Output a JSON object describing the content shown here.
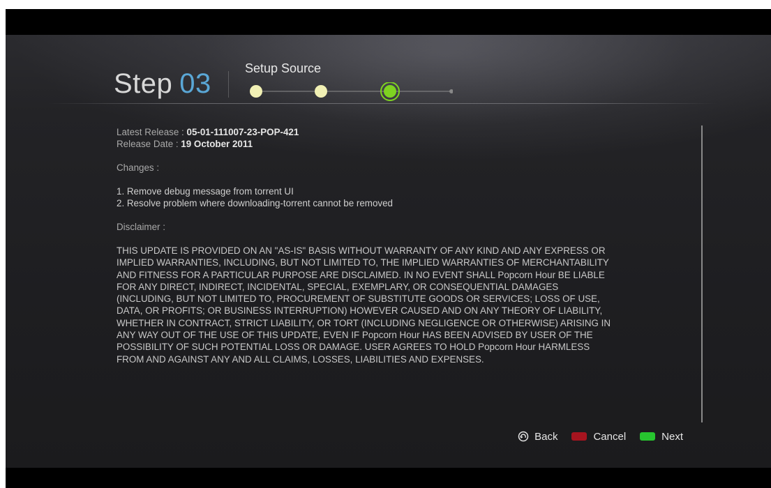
{
  "header": {
    "step_word": "Step",
    "step_number": "03",
    "title": "Setup Source",
    "progress": {
      "total_steps": 4,
      "current_step": 3,
      "completed_color": "#f1f0b4",
      "active_color": "#7ed321",
      "pending_color": "#888888"
    }
  },
  "release": {
    "latest_label": "Latest Release : ",
    "latest_value": "05-01-111007-23-POP-421",
    "date_label": "Release Date : ",
    "date_value": "19 October 2011"
  },
  "changes": {
    "heading": "Changes :",
    "items": [
      "1. Remove debug message from torrent UI",
      "2. Resolve problem where downloading-torrent cannot be removed"
    ]
  },
  "disclaimer": {
    "heading": "Disclaimer :",
    "lines": [
      "THIS UPDATE IS PROVIDED ON AN \"AS-IS\" BASIS WITHOUT WARRANTY OF ANY KIND AND ANY EXPRESS OR",
      "IMPLIED WARRANTIES, INCLUDING, BUT NOT LIMITED TO, THE IMPLIED WARRANTIES OF MERCHANTABILITY",
      "AND FITNESS FOR A PARTICULAR PURPOSE ARE DISCLAIMED. IN NO EVENT SHALL Popcorn Hour BE LIABLE",
      "FOR ANY DIRECT, INDIRECT, INCIDENTAL, SPECIAL, EXEMPLARY, OR CONSEQUENTIAL DAMAGES",
      "(INCLUDING, BUT NOT LIMITED TO, PROCUREMENT OF SUBSTITUTE GOODS OR SERVICES; LOSS OF USE,",
      "DATA, OR PROFITS; OR BUSINESS INTERRUPTION) HOWEVER CAUSED AND ON ANY THEORY OF LIABILITY,",
      "WHETHER IN CONTRACT, STRICT LIABILITY, OR TORT (INCLUDING NEGLIGENCE OR OTHERWISE) ARISING IN",
      "ANY WAY OUT OF THE USE OF THIS UPDATE, EVEN IF Popcorn Hour HAS BEEN ADVISED BY USER OF THE",
      "POSSIBILITY OF SUCH POTENTIAL LOSS OR DAMAGE. USER AGREES TO HOLD Popcorn Hour HARMLESS",
      "FROM AND AGAINST ANY AND ALL CLAIMS, LOSSES, LIABILITIES AND EXPENSES."
    ]
  },
  "footer": {
    "back_label": "Back",
    "back_icon": "back-remote-icon",
    "cancel_label": "Cancel",
    "cancel_color": "#a6141f",
    "next_label": "Next",
    "next_color": "#27c52f"
  }
}
